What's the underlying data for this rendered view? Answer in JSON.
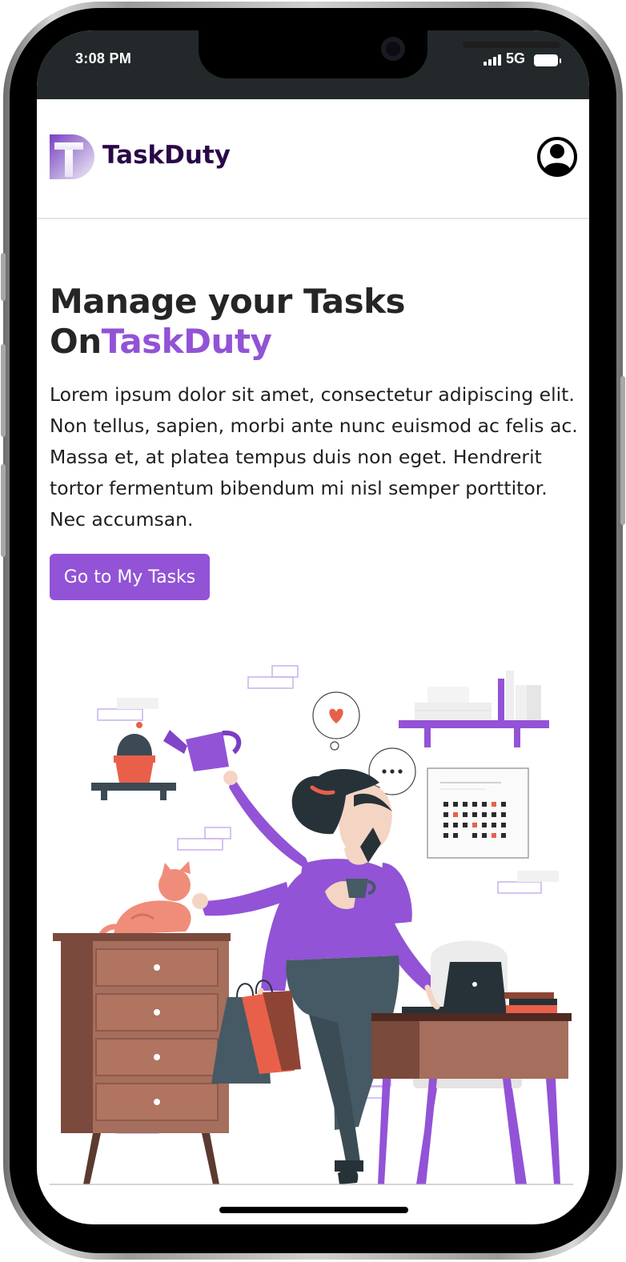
{
  "status_bar": {
    "time": "3:08 PM",
    "network": "5G"
  },
  "app": {
    "brand": "TaskDuty",
    "logo_letter": "T"
  },
  "hero": {
    "title_line1": "Manage your Tasks",
    "title_on": "On",
    "title_brand": "TaskDuty",
    "body": "Lorem ipsum dolor sit amet, consectetur adipiscing elit. Non tellus, sapien, morbi ante nunc euismod ac felis ac. Massa et, at platea tempus duis non eget. Hendrerit tortor fermentum bibendum mi nisl semper porttitor. Nec accumsan.",
    "cta_label": "Go to My Tasks"
  },
  "colors": {
    "accent": "#9253d6",
    "brand_text": "#2a0847",
    "status_bar": "#23282b"
  },
  "icons": [
    "signal-icon",
    "battery-icon",
    "profile-icon",
    "logo-icon",
    "heart-icon"
  ]
}
